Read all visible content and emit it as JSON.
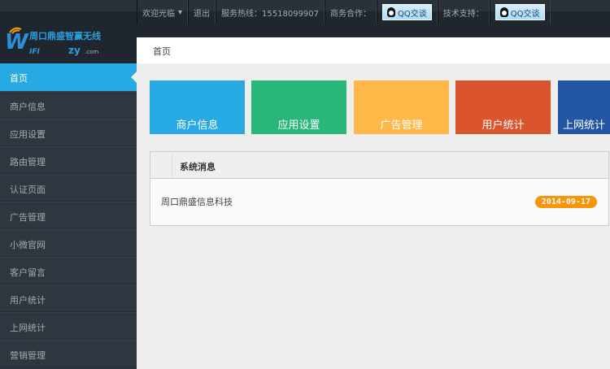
{
  "header": {
    "welcome": "欢迎光临",
    "logout": "退出",
    "hotline": "服务热线：15518099907",
    "business": "商务合作：",
    "qq1": "QQ交谈",
    "support": "技术支持：",
    "qq2": "QQ交谈"
  },
  "logo": {
    "title": "周口鼎盛智赢无线",
    "sub": "WIFI zy.com"
  },
  "breadcrumb": "首页",
  "sidebar": {
    "items": [
      {
        "label": "首页"
      },
      {
        "label": "商户信息"
      },
      {
        "label": "应用设置"
      },
      {
        "label": "路由管理"
      },
      {
        "label": "认证页面"
      },
      {
        "label": "广告管理"
      },
      {
        "label": "小微官网"
      },
      {
        "label": "客户留言"
      },
      {
        "label": "用户统计"
      },
      {
        "label": "上网统计"
      },
      {
        "label": "营销管理"
      }
    ]
  },
  "tiles": [
    {
      "label": "商户信息",
      "color": "#27a9e3"
    },
    {
      "label": "应用设置",
      "color": "#28b779"
    },
    {
      "label": "广告管理",
      "color": "#ffb848"
    },
    {
      "label": "用户统计",
      "color": "#da542e"
    },
    {
      "label": "上网统计",
      "color": "#2255a4"
    }
  ],
  "messages": {
    "title": "系统消息",
    "items": [
      {
        "text": "周口鼎盛信息科技",
        "date": "2014-09-17"
      }
    ]
  }
}
